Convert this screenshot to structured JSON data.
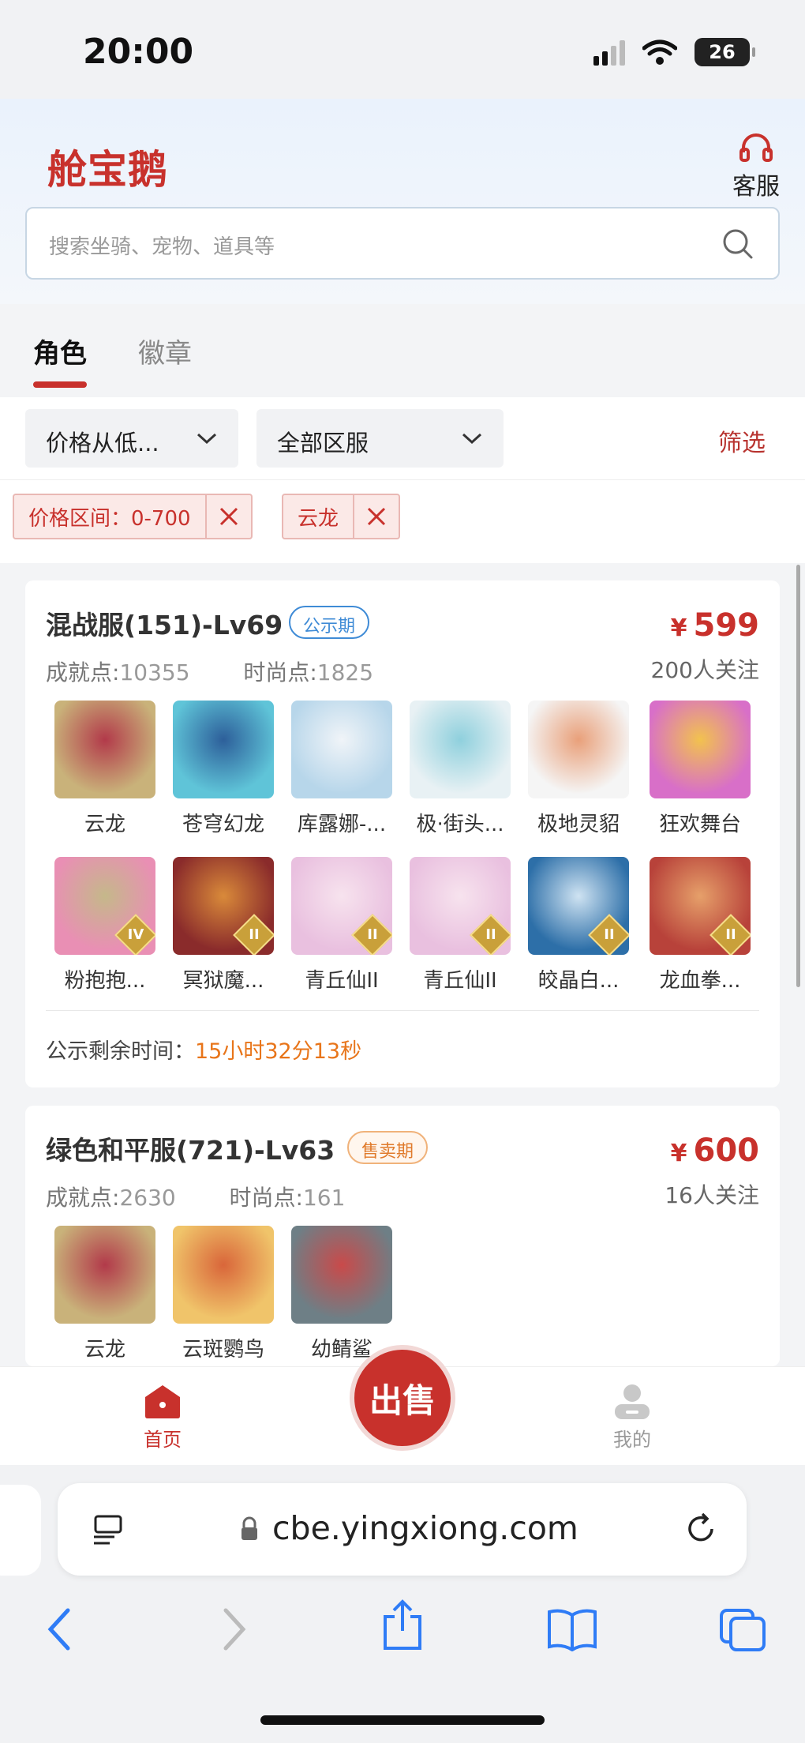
{
  "status_bar": {
    "time": "20:00",
    "battery": "26"
  },
  "header": {
    "logo": "舱宝鹅",
    "service_label": "客服",
    "search_placeholder": "搜索坐骑、宠物、道具等"
  },
  "tabs": [
    {
      "label": "角色",
      "active": true
    },
    {
      "label": "徽章",
      "active": false
    }
  ],
  "filters": {
    "sort_label": "价格从低...",
    "server_label": "全部区服",
    "filter_label": "筛选",
    "chips": [
      {
        "label": "价格区间：0-700"
      },
      {
        "label": "云龙"
      }
    ]
  },
  "listings": [
    {
      "server": "混战服(151)-Lv69",
      "badge": "公示期",
      "price_symbol": "¥",
      "price": "599",
      "stats_label1": "成就点:",
      "stats_val1": "10355",
      "stats_label2": "时尚点:",
      "stats_val2": "1825",
      "followers": "200人关注",
      "items": [
        {
          "name": "云龙",
          "icon": "dragon-icon",
          "tier": ""
        },
        {
          "name": "苍穹幻龙",
          "icon": "azure-dragon-icon",
          "tier": ""
        },
        {
          "name": "库露娜-...",
          "icon": "sheep-girl-icon",
          "tier": ""
        },
        {
          "name": "极·街头...",
          "icon": "skateboard-icon",
          "tier": ""
        },
        {
          "name": "极地灵貂",
          "icon": "polar-mink-icon",
          "tier": ""
        },
        {
          "name": "狂欢舞台",
          "icon": "heart-stage-icon",
          "tier": ""
        },
        {
          "name": "粉抱抱...",
          "icon": "pink-bear-icon",
          "tier": "IV"
        },
        {
          "name": "冥狱魔...",
          "icon": "dark-dragon-icon",
          "tier": "II"
        },
        {
          "name": "青丘仙II",
          "icon": "fox-fairy-icon",
          "tier": "II"
        },
        {
          "name": "青丘仙II",
          "icon": "fox-fairy-icon",
          "tier": "II"
        },
        {
          "name": "皎晶白...",
          "icon": "white-tiger-icon",
          "tier": "II"
        },
        {
          "name": "龙血拳...",
          "icon": "red-beast-icon",
          "tier": "II"
        }
      ],
      "countdown_label": "公示剩余时间：",
      "countdown_value": "15小时32分13秒"
    },
    {
      "server": "绿色和平服(721)-Lv63",
      "badge": "售卖期",
      "price_symbol": "¥",
      "price": "600",
      "stats_label1": "成就点:",
      "stats_val1": "2630",
      "stats_label2": "时尚点:",
      "stats_val2": "161",
      "followers": "16人关注",
      "items": [
        {
          "name": "云龙",
          "icon": "dragon-icon",
          "tier": ""
        },
        {
          "name": "云斑鹦鸟",
          "icon": "parrot-icon",
          "tier": ""
        },
        {
          "name": "幼鲭鲨",
          "icon": "shark-icon",
          "tier": ""
        }
      ]
    }
  ],
  "tabbar": {
    "home_label": "首页",
    "sell_label": "出售",
    "mine_label": "我的"
  },
  "browser": {
    "url": "cbe.yingxiong.com"
  },
  "colors": {
    "accent": "#c8312c",
    "countdown": "#e8751a",
    "badge_blue": "#3f8bd6"
  }
}
